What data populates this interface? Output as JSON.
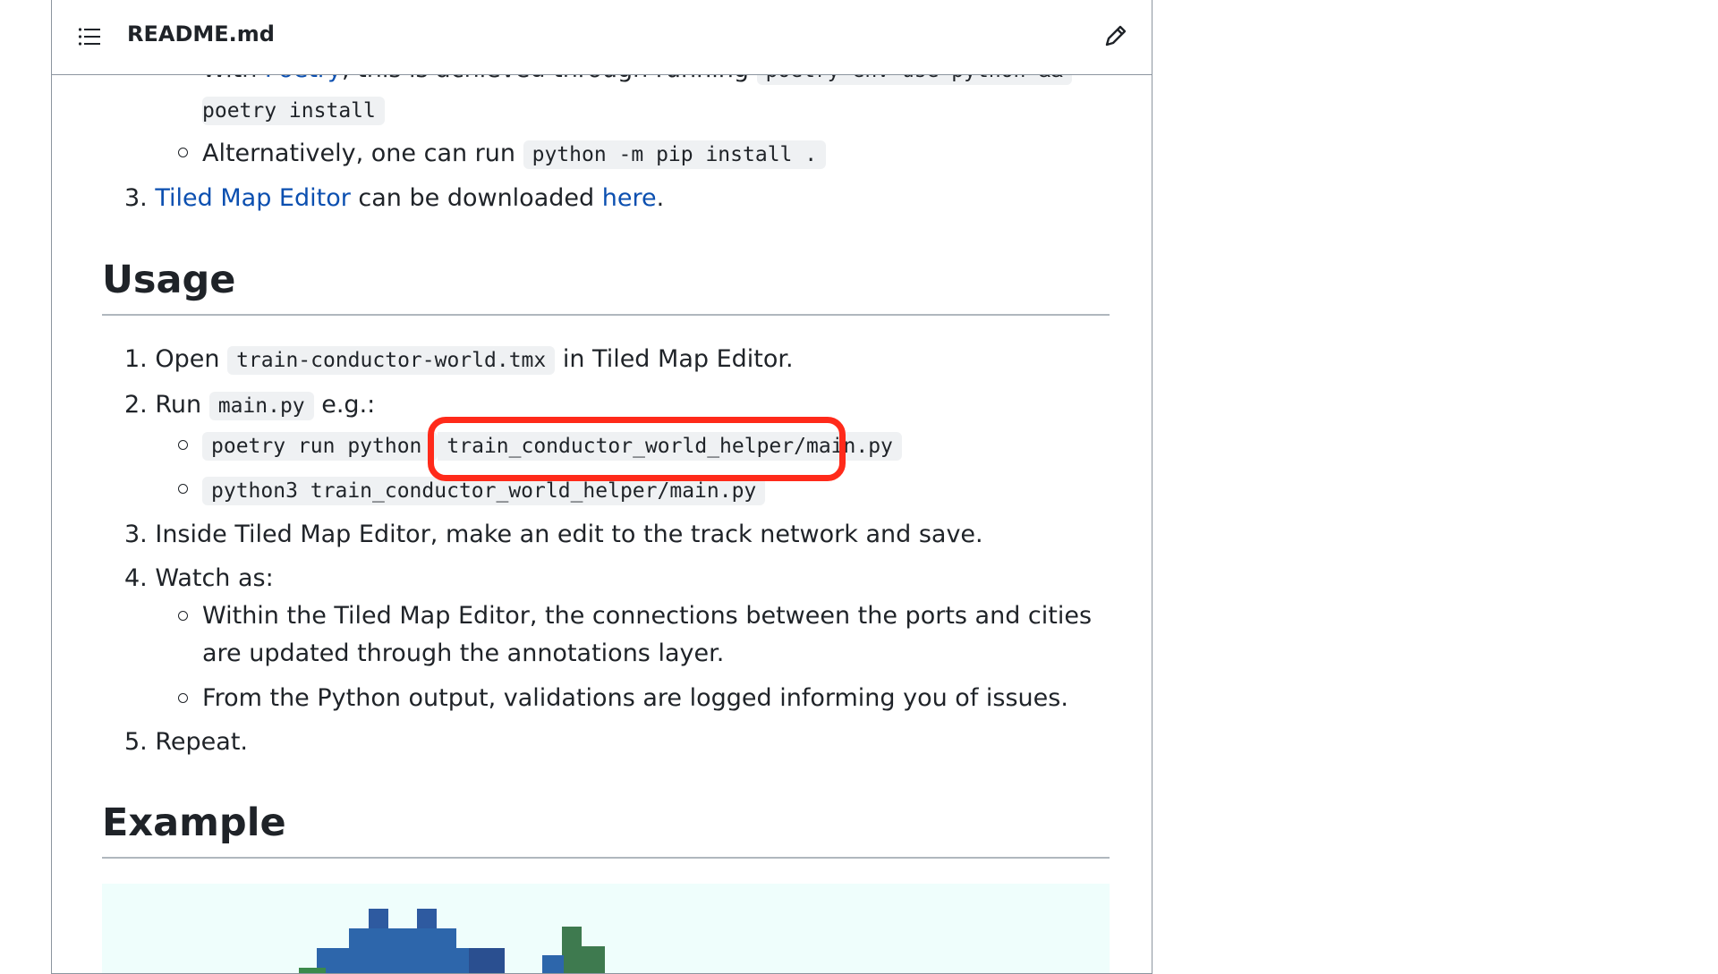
{
  "header": {
    "file_title": "README.md",
    "toc_icon": "list-icon",
    "edit_icon": "pencil-icon"
  },
  "install": {
    "partial_line_1_prefix": "With ",
    "poetry_link": "Poetry",
    "partial_line_1_mid": ", this is achieved through running ",
    "poetry_cmd_1": "poetry env use python &&",
    "poetry_cmd_2": "poetry install",
    "alt_text": "Alternatively, one can run ",
    "alt_cmd": "python -m pip install .",
    "step3_num": "3.",
    "tiled_link": "Tiled Map Editor",
    "step3_mid": " can be downloaded ",
    "here_link": "here",
    "step3_end": "."
  },
  "usage": {
    "heading": "Usage",
    "step1_num": "1.",
    "step1_pre": "Open ",
    "step1_code": "train-conductor-world.tmx",
    "step1_post": " in Tiled Map Editor.",
    "step2_num": "2.",
    "step2_pre": "Run ",
    "step2_code": "main.py",
    "step2_post": " e.g.:",
    "cmd_a_part1": "poetry run python",
    "cmd_a_part2": "train_conductor_world_helper/main.py",
    "cmd_b": "python3 train_conductor_world_helper/main.py",
    "step3_num": "3.",
    "step3_text": "Inside Tiled Map Editor, make an edit to the track network and save.",
    "step4_num": "4.",
    "step4_text": "Watch as:",
    "watch_a_line1": "Within the Tiled Map Editor, the connections between the ports and cities",
    "watch_a_line2": "are updated through the annotations layer.",
    "watch_b": "From the Python output, validations are logged informing you of issues.",
    "step5_num": "5.",
    "step5_text": "Repeat."
  },
  "example": {
    "heading": "Example"
  },
  "colors": {
    "link": "#0b4fb0",
    "highlight": "#ff2a1a",
    "code_bg": "#eff1f3"
  }
}
